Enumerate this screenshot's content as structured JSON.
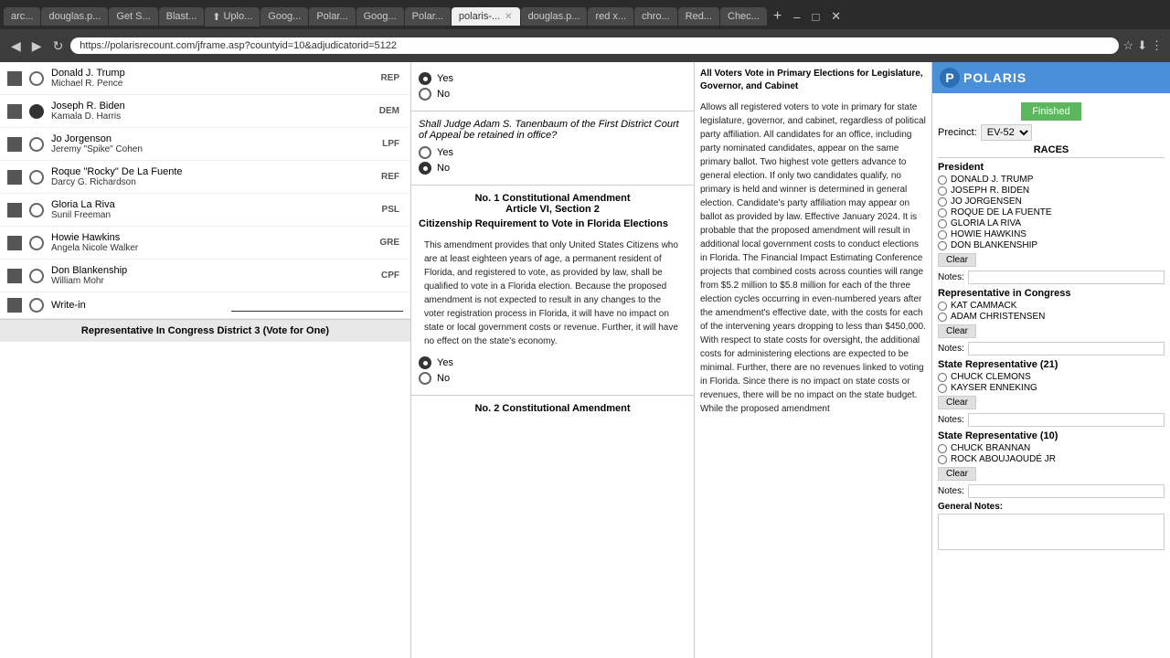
{
  "browser": {
    "tabs": [
      {
        "label": "arc...",
        "active": false
      },
      {
        "label": "douglas.p...",
        "active": false
      },
      {
        "label": "Get S...",
        "active": false
      },
      {
        "label": "Blast...",
        "active": false
      },
      {
        "label": "Uplo...",
        "active": false
      },
      {
        "label": "Goog...",
        "active": false
      },
      {
        "label": "Polar...",
        "active": false
      },
      {
        "label": "Goog...",
        "active": false
      },
      {
        "label": "Polar...",
        "active": false
      },
      {
        "label": "polaris-...",
        "active": true
      },
      {
        "label": "douglas.p...",
        "active": false
      },
      {
        "label": "red x...",
        "active": false
      },
      {
        "label": "chro...",
        "active": false
      },
      {
        "label": "Red...",
        "active": false
      },
      {
        "label": "Chec...",
        "active": false
      }
    ],
    "address": "https://polarisrecount.com/jframe.asp?countyid=10&adjudicatorid=5122"
  },
  "candidates": [
    {
      "name": "Donald J. Trump",
      "running_mate": "Michael R. Pence",
      "party": "REP",
      "selected": false
    },
    {
      "name": "Joseph R. Biden",
      "running_mate": "Kamala D. Harris",
      "party": "DEM",
      "selected": true
    },
    {
      "name": "Jo Jorgenson",
      "running_mate": "Jeremy \"Spike\" Cohen",
      "party": "LPF",
      "selected": false
    },
    {
      "name": "Roque \"Rocky\" De La Fuente",
      "running_mate": "Darcy G. Richardson",
      "party": "REF",
      "selected": false
    },
    {
      "name": "Gloria La Riva",
      "running_mate": "Sunil Freeman",
      "party": "PSL",
      "selected": false
    },
    {
      "name": "Howie Hawkins",
      "running_mate": "Angela Nicole Walker",
      "party": "GRE",
      "selected": false
    },
    {
      "name": "Don Blankenship",
      "running_mate": "William Mohr",
      "party": "CPF",
      "selected": false
    },
    {
      "name": "Write-in",
      "running_mate": "",
      "party": "",
      "selected": false
    }
  ],
  "rep_congress_header": "Representative In Congress District 3\n(Vote for One)",
  "measures": [
    {
      "type": "question",
      "question": "Shall Judge Adam S. Tanenbaum of the First District Court of Appeal be retained in office?",
      "yes_selected": false,
      "no_selected": true
    },
    {
      "type": "amendment",
      "number": "No. 1 Constitutional Amendment\nArticle VI, Section 2",
      "title": "Citizenship Requirement to Vote in Florida Elections",
      "description": "This amendment provides that only United States Citizens who are at least eighteen years of age, a permanent resident of Florida, and registered to vote, as provided by law, shall be qualified to vote in a Florida election. Because the proposed amendment is not expected to result in any changes to the voter registration process in Florida, it will have no impact on state or local government costs or revenue. Further, it will have no effect on the state's economy.",
      "yes_selected": true,
      "no_selected": false
    },
    {
      "type": "next_amendment",
      "label": "No. 2 Constitutional Amendment"
    }
  ],
  "info_panel": {
    "header": "All Voters Vote in Primary Elections for Legislature, Governor, and Cabinet",
    "text": "Allows all registered voters to vote in primary for state legislature, governor, and cabinet, regardless of political party affiliation. All candidates for an office, including party nominated candidates, appear on the same primary ballot. Two highest vote getters advance to general election. If only two candidates qualify, no primary is held and winner is determined in general election. Candidate's party affiliation may appear on ballot as provided by law. Effective January 2024.\n\nIt is probable that the proposed amendment will result in additional local government costs to conduct elections in Florida. The Financial Impact Estimating Conference projects that combined costs across counties will range from $5.2 million to $5.8 million for each of the three election cycles occurring in even-numbered years after the amendment's effective date, with the costs for each of the intervening years dropping to less than $450,000. With respect to state costs for oversight, the additional costs for administering elections are expected to be minimal. Further, there are no revenues linked to voting in Florida. Since there is no impact on state costs or revenues, there will be no impact on the state budget. While the proposed amendment"
  },
  "polaris": {
    "title": "POLARIS",
    "status": "Finished",
    "precinct_label": "Precinct:",
    "precinct_value": "EV-52",
    "races_label": "RACES",
    "president_label": "President",
    "president_options": [
      "DONALD J. TRUMP",
      "JOSEPH R. BIDEN",
      "JO JORGENSEN",
      "ROQUE DE LA FUENTE",
      "GLORIA LA RIVA",
      "HOWIE HAWKINS",
      "DON BLANKENSHIP"
    ],
    "president_clear": "Clear",
    "rep_congress_label": "Representative in Congress",
    "rep_congress_options": [
      "KAT CAMMACK",
      "ADAM CHRISTENSEN"
    ],
    "rep_congress_clear": "Clear",
    "state_rep_21_label": "State Representative (21)",
    "state_rep_21_options": [
      "CHUCK CLEMONS",
      "KAYSER ENNEKING"
    ],
    "state_rep_21_clear": "Clear",
    "state_rep_10_label": "State Representative (10)",
    "state_rep_10_options": [
      "CHUCK BRANNAN",
      "ROCK ABOUJAOUDÉ JR"
    ],
    "state_rep_10_clear": "Clear",
    "notes_label": "Notes:",
    "general_notes_label": "General Notes:"
  }
}
